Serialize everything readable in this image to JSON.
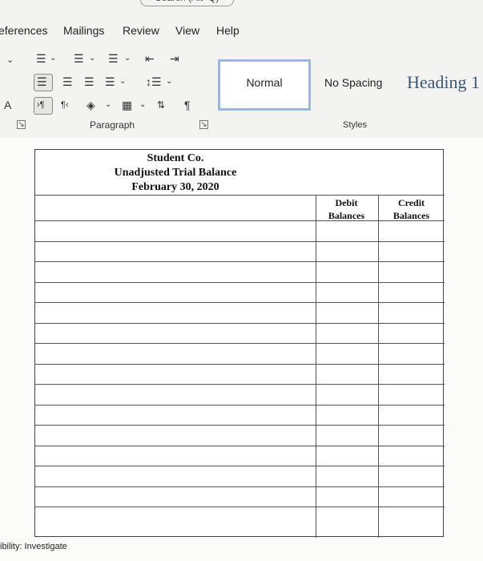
{
  "ribbon": {
    "search_fragment": "Search (Alt+Q)",
    "tabs": [
      "eferences",
      "Mailings",
      "Review",
      "View",
      "Help"
    ],
    "paragraph_group_label": "Paragraph",
    "styles_group_label": "Styles",
    "font_group_fragment": "A",
    "styles": {
      "normal": "Normal",
      "no_spacing": "No Spacing",
      "heading": "Heading 1"
    },
    "icons": [
      "bullets-icon",
      "numbering-icon",
      "multilevel-list-icon",
      "decrease-indent-icon",
      "increase-indent-icon",
      "align-left-icon",
      "align-center-icon",
      "align-right-icon",
      "justify-icon",
      "line-spacing-icon",
      "ltr-icon",
      "rtl-icon",
      "shading-icon",
      "borders-icon",
      "sort-icon",
      "show-formatting-icon"
    ],
    "accent_color": "#9bb7dc"
  },
  "document": {
    "company": "Student Co.",
    "report_title": "Unadjusted Trial Balance",
    "date": "February 30, 2020",
    "debit_header_line1": "Debit",
    "debit_header_line2": "Balances",
    "credit_header_line1": "Credit",
    "credit_header_line2": "Balances"
  },
  "status_bar": {
    "accessibility": "ibility: Investigate"
  }
}
